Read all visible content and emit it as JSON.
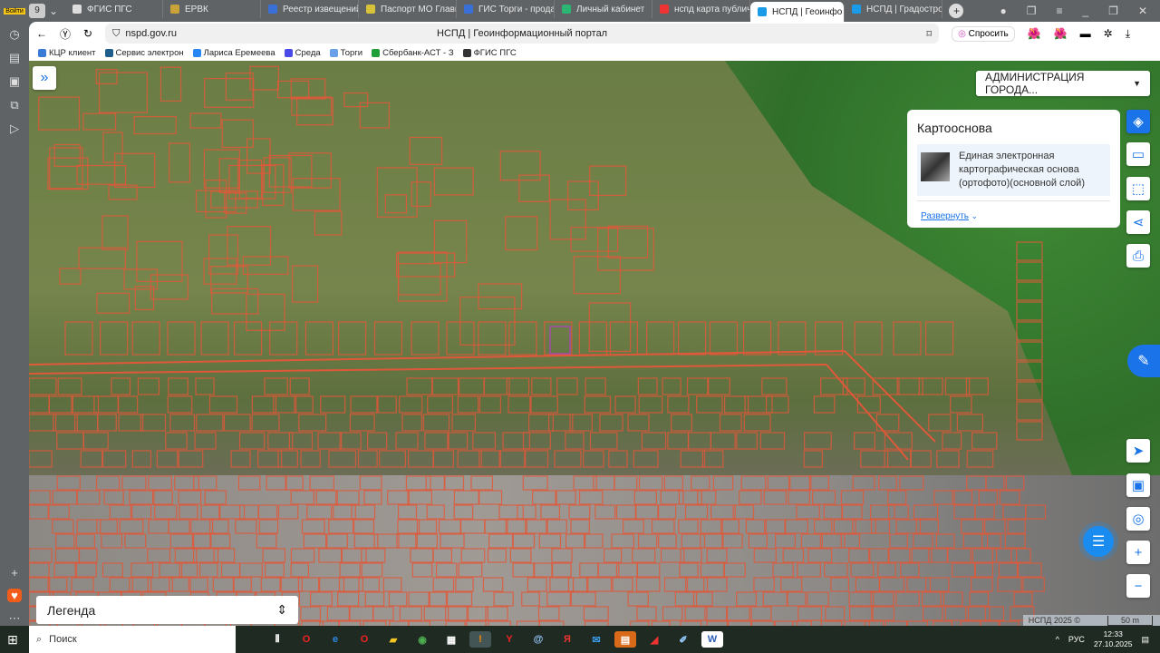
{
  "browser": {
    "login_label": "Войти",
    "tab_count": "9",
    "tabs": [
      {
        "label": "ФГИС ПГС",
        "color": "#ddd"
      },
      {
        "label": "ЕРВК",
        "color": "#c9a33a"
      },
      {
        "label": "Реестр извещений",
        "color": "#3a6fd8"
      },
      {
        "label": "Паспорт МО Главн",
        "color": "#d8c23a"
      },
      {
        "label": "ГИС Торги - прода",
        "color": "#3a6fd8"
      },
      {
        "label": "Личный кабинет",
        "color": "#2bb673"
      },
      {
        "label": "нспд карта публич",
        "color": "#e33"
      },
      {
        "label": "НСПД | Геоинфо",
        "color": "#1a9be8",
        "active": true
      },
      {
        "label": "НСПД | Градострои",
        "color": "#1a9be8"
      }
    ],
    "url": "nspd.gov.ru",
    "page_title": "НСПД | Геоинформационный портал",
    "ask_label": "Спросить",
    "bookmarks": [
      {
        "label": "КЦР клиент",
        "color": "#3a7bd5"
      },
      {
        "label": "Сервис электрон",
        "color": "#1d5e8c"
      },
      {
        "label": "Лариса Еремеева",
        "color": "#2787f5"
      },
      {
        "label": "Среда",
        "color": "#4a4ae8"
      },
      {
        "label": "Торги",
        "color": "#6aa0e8"
      },
      {
        "label": "Сбербанк-АСТ - З",
        "color": "#21a038"
      },
      {
        "label": "ФГИС ПГС",
        "color": "#333"
      }
    ]
  },
  "map": {
    "admin_select": "АДМИНИСТРАЦИЯ ГОРОДА...",
    "panel": {
      "title": "Картооснова",
      "layer": "Единая электронная картографическая основа (ортофото)(основной слой)",
      "expand": "Развернуть"
    },
    "legend": "Легенда",
    "attribution": "НСПД 2025 ©",
    "scale": "50 m",
    "parcel_color": "#e0583a",
    "accent": "#1a73e8"
  },
  "taskbar": {
    "search_placeholder": "Поиск",
    "lang": "РУС",
    "time": "12:33",
    "date": "27.10.2025"
  }
}
